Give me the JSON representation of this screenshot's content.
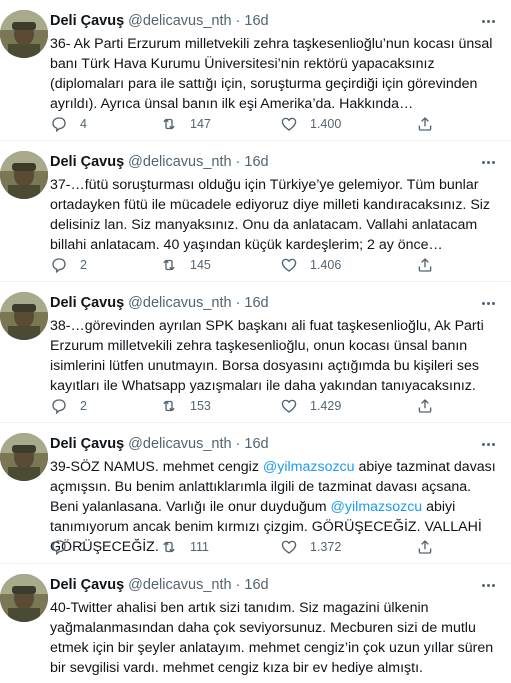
{
  "tweets": [
    {
      "name": "Deli Çavuş",
      "handle": "@delicavus_nth",
      "time": "16d",
      "text": [
        {
          "t": "36- Ak Parti Erzurum milletvekili zehra taşkesenlioğlu’nun kocası ünsal banı Türk Hava Kurumu Üniversitesi’nin rektörü yapacaksınız (diplomaları para ile sattığı için, soruşturma geçirdiği için görevinden ayrıldı). Ayrıca ünsal banın ilk eşi Amerika’da. Hakkında…"
        }
      ],
      "replies": "4",
      "retweets": "147",
      "likes": "1.400"
    },
    {
      "name": "Deli Çavuş",
      "handle": "@delicavus_nth",
      "time": "16d",
      "text": [
        {
          "t": "37-…fütü soruşturması olduğu için Türkiye’ye gelemiyor. Tüm bunlar ortadayken fütü ile mücadele ediyoruz diye milleti kandıracaksınız. Siz delisiniz lan. Siz manyaksınız. Onu da anlatacam. Vallahi anlatacam billahi anlatacam. 40 yaşından küçük kardeşlerim; 2 ay önce…"
        }
      ],
      "replies": "2",
      "retweets": "145",
      "likes": "1.406"
    },
    {
      "name": "Deli Çavuş",
      "handle": "@delicavus_nth",
      "time": "16d",
      "text": [
        {
          "t": "38-…görevinden ayrılan SPK başkanı ali fuat taşkesenlioğlu, Ak Parti Erzurum milletvekili zehra taşkesenlioğlu, onun kocası ünsal banın isimlerini lütfen unutmayın. Borsa dosyasını açtığımda bu kişileri ses kayıtları ile Whatsapp yazışmaları ile daha yakından tanıyacaksınız."
        }
      ],
      "replies": "2",
      "retweets": "153",
      "likes": "1.429"
    },
    {
      "name": "Deli Çavuş",
      "handle": "@delicavus_nth",
      "time": "16d",
      "text": [
        {
          "t": "39-SÖZ NAMUS. mehmet cengiz "
        },
        {
          "t": "@yilmazsozcu",
          "mention": true
        },
        {
          "t": " abiye tazminat davası açmışsın. Bu benim anlattıklarımla ilgili de tazminat davası açsana. Beni yalanlasana. Varlığı ile onur duyduğum "
        },
        {
          "t": "@yilmazsozcu",
          "mention": true
        },
        {
          "t": " abiyi tanımıyorum ancak benim kırmızı çizgim. GÖRÜŞECEĞİZ. VALLAHİ GÖRÜŞECEĞİZ."
        }
      ],
      "replies": "1",
      "retweets": "111",
      "likes": "1.372"
    },
    {
      "name": "Deli Çavuş",
      "handle": "@delicavus_nth",
      "time": "16d",
      "text": [
        {
          "t": "40-Twitter ahalisi ben artık sizi tanıdım. Siz magazini ülkenin yağmalanmasından daha çok seviyorsunuz. Mecburen sizi de mutlu etmek için bir şeyler anlatayım. mehmet cengiz’in çok uzun yıllar süren bir sevgilisi vardı. mehmet cengiz kıza bir ev hediye almıştı."
        }
      ],
      "replies": "",
      "retweets": "",
      "likes": ""
    }
  ],
  "icons": {
    "reply": "reply-icon",
    "retweet": "retweet-icon",
    "like": "heart-icon",
    "share": "share-icon",
    "more": "more-icon"
  },
  "colors": {
    "text": "#0f1419",
    "secondary": "#536471",
    "mention": "#1d9bf0",
    "divider": "#eff3f4"
  }
}
